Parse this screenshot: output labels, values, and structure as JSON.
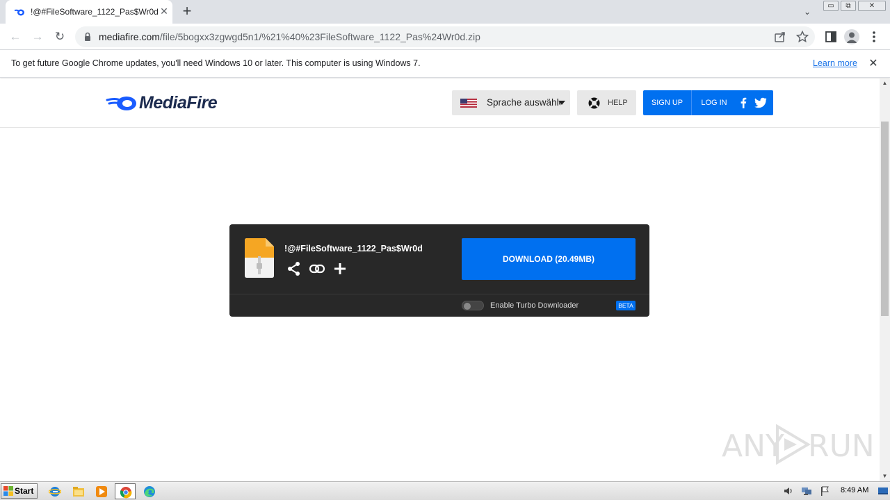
{
  "browser": {
    "tab": {
      "title": "!@#FileSoftware_1122_Pas$Wr0d",
      "close": "✕"
    },
    "new_tab": "+",
    "tab_search": "⌄",
    "window_buttons": {
      "minimize": "▭",
      "restore": "⧉",
      "close": "✕"
    },
    "nav": {
      "back": "←",
      "forward": "→",
      "reload": "↻"
    },
    "url": {
      "host": "mediafire.com",
      "path": "/file/5bogxx3zgwgd5n1/%21%40%23FileSoftware_1122_Pas%24Wr0d.zip"
    },
    "infobar": {
      "message": "To get future Google Chrome updates, you'll need Windows 10 or later. This computer is using Windows 7.",
      "link": "Learn more",
      "close": "✕"
    }
  },
  "site": {
    "logo": "MediaFire",
    "language_select": {
      "value": "Sprache auswählen"
    },
    "help": "HELP",
    "signup": "SIGN UP",
    "login": "LOG IN",
    "accent_color": "#0070f0"
  },
  "download": {
    "file_name": "!@#FileSoftware_1122_Pas$Wr0d",
    "button": "DOWNLOAD (20.49MB)",
    "turbo_label": "Enable Turbo Downloader",
    "turbo_enabled": false,
    "beta_badge": "BETA",
    "actions": [
      "share-icon",
      "link-icon",
      "add-icon"
    ]
  },
  "watermark": {
    "left": "ANY",
    "right": "RUN"
  },
  "taskbar": {
    "start": "Start",
    "apps": [
      "internet-explorer-icon",
      "file-explorer-icon",
      "media-player-icon",
      "chrome-icon",
      "edge-icon"
    ],
    "clock": "8:49 AM"
  }
}
